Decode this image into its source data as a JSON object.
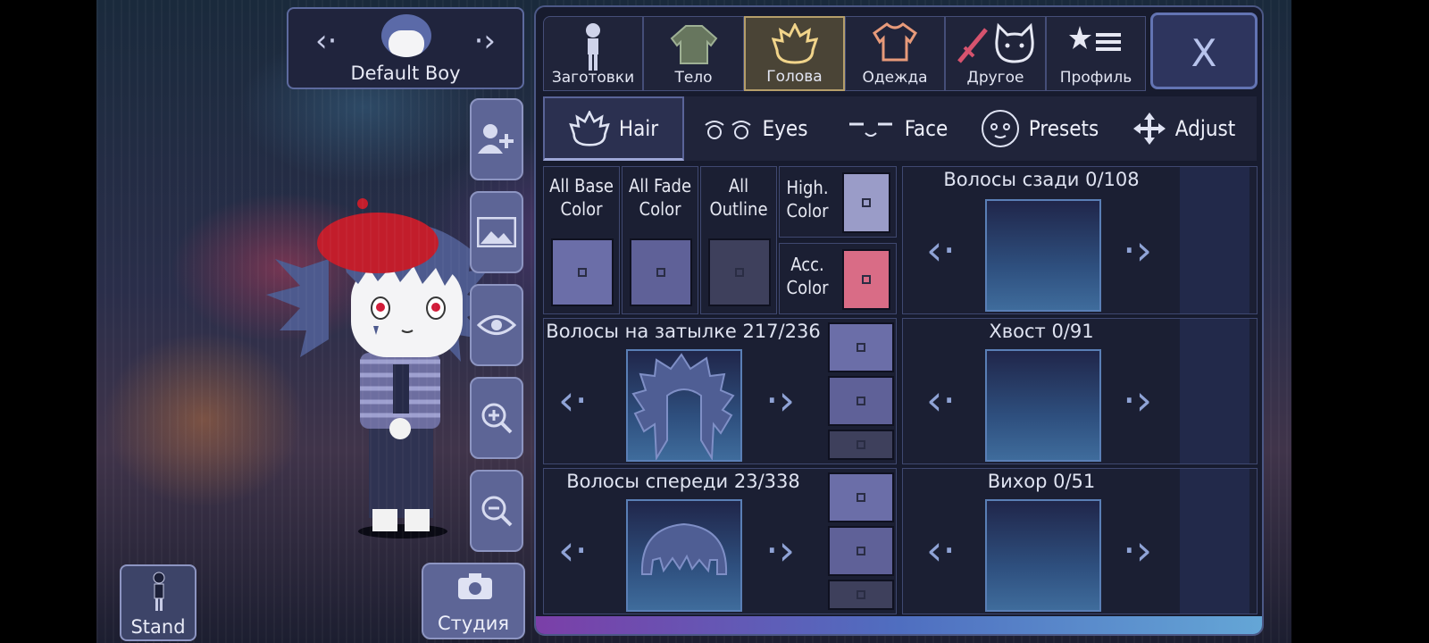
{
  "character": {
    "name": "Default Boy"
  },
  "side_buttons": {
    "stand_label": "Stand",
    "studio_label": "Студия"
  },
  "top_tabs": [
    {
      "label": "Заготовки",
      "icon": "body-preset-icon"
    },
    {
      "label": "Тело",
      "icon": "jacket-icon"
    },
    {
      "label": "Голова",
      "icon": "hair-icon"
    },
    {
      "label": "Одежда",
      "icon": "shirt-icon"
    },
    {
      "label": "Другое",
      "icon": "sword-cat-icon"
    },
    {
      "label": "Профиль",
      "icon": "star-list-icon"
    }
  ],
  "close_label": "X",
  "sub_tabs": [
    {
      "label": "Hair"
    },
    {
      "label": "Eyes"
    },
    {
      "label": "Face"
    },
    {
      "label": "Presets"
    },
    {
      "label": "Adjust"
    }
  ],
  "colors": {
    "all_base": {
      "line1": "All Base",
      "line2": "Color",
      "swatch": "#6b6ea8"
    },
    "all_fade": {
      "line1": "All Fade",
      "line2": "Color",
      "swatch": "#5f6198"
    },
    "all_outline": {
      "line1": "All",
      "line2": "Outline",
      "swatch": "#3e405c"
    },
    "high": {
      "line1": "High.",
      "line2": "Color",
      "swatch": "#9a9cc8"
    },
    "acc": {
      "line1": "Acc.",
      "line2": "Color",
      "swatch": "#d96c86"
    }
  },
  "sections": {
    "back_hair": {
      "title": "Волосы сзади 0/108"
    },
    "nape_hair": {
      "title": "Волосы на затылке 217/236"
    },
    "front_hair": {
      "title": "Волосы спереди 23/338"
    },
    "tail": {
      "title": "Хвост 0/91"
    },
    "ahoge": {
      "title": "Вихор 0/51"
    }
  }
}
